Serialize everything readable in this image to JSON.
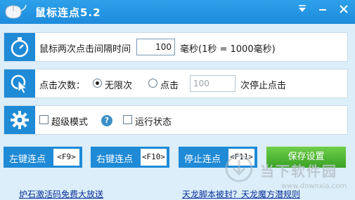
{
  "window": {
    "title": "鼠标连点5.2"
  },
  "interval_row": {
    "label": "鼠标两次点击间隔时间",
    "value": "100",
    "unit_note": "毫秒(1秒 = 1000毫秒)"
  },
  "count_row": {
    "label": "点击次数：",
    "option_unlimited": "无限次",
    "option_click": "点击",
    "count_value": "100",
    "suffix": "次停止点击",
    "selected": "无限次"
  },
  "settings_row": {
    "super_mode_label": "超级模式",
    "super_mode_checked": false,
    "help_glyph": "?",
    "run_state_label": "运行状态",
    "run_state_checked": false
  },
  "hotkeys": {
    "left_label": "左键连点",
    "left_key": "<F9>",
    "right_label": "右键连点",
    "right_key": "<F10>",
    "stop_label": "停止连点",
    "stop_key": "<F11>",
    "save_label": "保存设置"
  },
  "links": {
    "left": "炉石激活码免费大放送",
    "right": "天龙脚本被封？天龙魔方潜规则"
  },
  "watermark": {
    "text": "当下软件园",
    "url": "www.downxia.com"
  },
  "colors": {
    "title_bar": "#1d8bdc",
    "accent_blue": "#1f8ad6",
    "save_green": "#4cb531",
    "background": "#dbeef9",
    "link": "#0a2f9a"
  }
}
